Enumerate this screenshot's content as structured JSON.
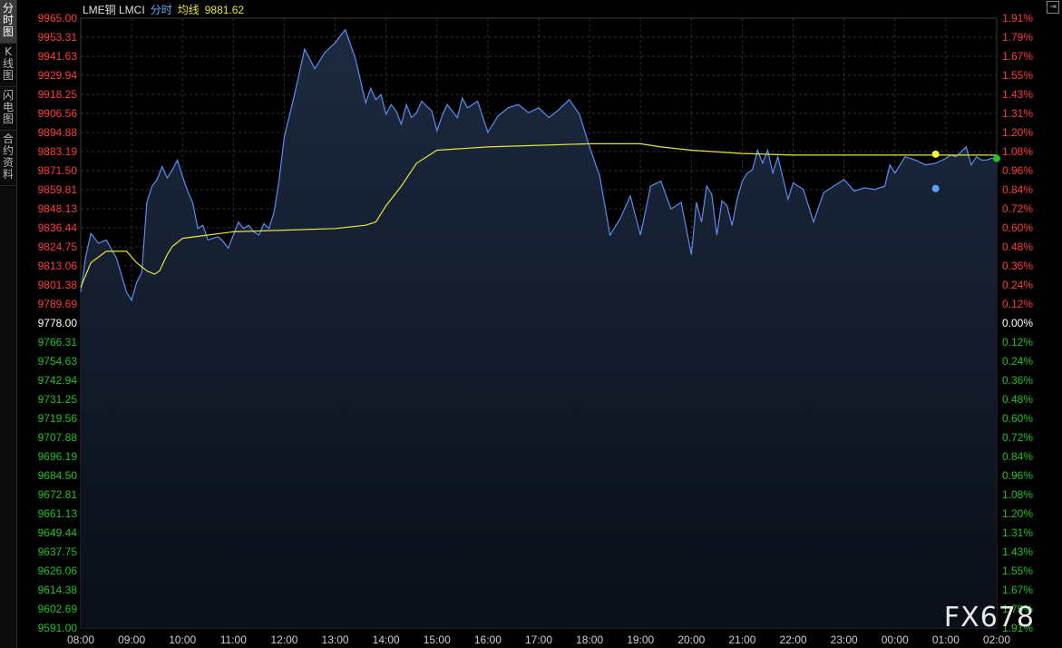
{
  "sidebar": {
    "tabs": [
      {
        "label": "分时图",
        "active": true
      },
      {
        "label": "K线图",
        "active": false
      },
      {
        "label": "闪电图",
        "active": false
      },
      {
        "label": "合约资料",
        "active": false
      }
    ]
  },
  "header": {
    "symbol": "LME铜 LMCI",
    "mode": "分时",
    "avg_label": "均线",
    "avg_value": "9881.62"
  },
  "watermark": "FX678",
  "colors": {
    "up": "#ff3b3b",
    "down": "#22c022",
    "flat": "#ffffff",
    "price_line": "#5a8ef2",
    "avg_line": "#e6e63a",
    "grid": "#2f2f2f",
    "fill_top": "#1c2a40",
    "fill_bottom": "#0a0f18"
  },
  "chart_data": {
    "type": "line",
    "title": "",
    "xlabel": "",
    "ylabel": "",
    "base_price": 9778.0,
    "ylim": [
      9591.0,
      9965.0
    ],
    "y_ticks": [
      "9965.00",
      "9953.31",
      "9941.63",
      "9929.94",
      "9918.25",
      "9906.56",
      "9894.88",
      "9883.19",
      "9871.50",
      "9859.81",
      "9848.13",
      "9836.44",
      "9824.75",
      "9813.06",
      "9801.38",
      "9789.69",
      "9778.00",
      "9766.31",
      "9754.63",
      "9742.94",
      "9731.25",
      "9719.56",
      "9707.88",
      "9696.19",
      "9684.50",
      "9672.81",
      "9661.13",
      "9649.44",
      "9637.75",
      "9626.06",
      "9614.38",
      "9602.69",
      "9591.00"
    ],
    "pct_ticks": [
      "1.91%",
      "1.79%",
      "1.67%",
      "1.55%",
      "1.43%",
      "1.31%",
      "1.20%",
      "1.08%",
      "0.96%",
      "0.84%",
      "0.72%",
      "0.60%",
      "0.48%",
      "0.36%",
      "0.24%",
      "0.12%",
      "0.00%",
      "0.12%",
      "0.24%",
      "0.36%",
      "0.48%",
      "0.60%",
      "0.72%",
      "0.84%",
      "0.96%",
      "1.08%",
      "1.20%",
      "1.31%",
      "1.43%",
      "1.55%",
      "1.67%",
      "1.79%",
      "1.91%"
    ],
    "x_ticks": [
      "08:00",
      "09:00",
      "10:00",
      "11:00",
      "12:00",
      "13:00",
      "14:00",
      "15:00",
      "16:00",
      "17:00",
      "18:00",
      "19:00",
      "20:00",
      "21:00",
      "22:00",
      "23:00",
      "00:00",
      "01:00",
      "02:00"
    ],
    "xlim_hours": [
      0,
      18
    ],
    "grid": true,
    "series": [
      {
        "name": "",
        "x": [
          0,
          0.1,
          0.2,
          0.35,
          0.5,
          0.7,
          0.9,
          1.0,
          1.1,
          1.2,
          1.3,
          1.4,
          1.5,
          1.6,
          1.7,
          1.8,
          1.9,
          2.0,
          2.1,
          2.2,
          2.3,
          2.4,
          2.5,
          2.6,
          2.7,
          2.8,
          2.9,
          3.0,
          3.1,
          3.2,
          3.3,
          3.4,
          3.5,
          3.6,
          3.7,
          3.8,
          3.9,
          4.0,
          4.2,
          4.4,
          4.6,
          4.8,
          5.0,
          5.2,
          5.4,
          5.6,
          5.7,
          5.8,
          5.9,
          6.0,
          6.1,
          6.2,
          6.3,
          6.4,
          6.5,
          6.6,
          6.7,
          6.8,
          6.9,
          7.0,
          7.1,
          7.2,
          7.3,
          7.4,
          7.5,
          7.6,
          7.8,
          8.0,
          8.2,
          8.4,
          8.6,
          8.8,
          9.0,
          9.2,
          9.4,
          9.6,
          9.8,
          10.0,
          10.2,
          10.4,
          10.6,
          10.8,
          11.0,
          11.2,
          11.4,
          11.6,
          11.8,
          12.0,
          12.1,
          12.2,
          12.3,
          12.4,
          12.5,
          12.6,
          12.7,
          12.8,
          12.9,
          13.0,
          13.1,
          13.2,
          13.3,
          13.4,
          13.5,
          13.6,
          13.7,
          13.8,
          13.9,
          14.0,
          14.2,
          14.4,
          14.6,
          14.8,
          15.0,
          15.2,
          15.4,
          15.6,
          15.8,
          15.9,
          16.0,
          16.2,
          16.4,
          16.6,
          16.8,
          17.0,
          17.1,
          17.2,
          17.3,
          17.4,
          17.5,
          17.6,
          17.7,
          17.8,
          17.9,
          18.0
        ],
        "values": [
          9797,
          9819,
          9833,
          9827,
          9829,
          9818,
          9797,
          9792,
          9803,
          9809,
          9852,
          9862,
          9866,
          9874,
          9867,
          9872,
          9878,
          9868,
          9859,
          9852,
          9836,
          9838,
          9829,
          9830,
          9831,
          9828,
          9824,
          9832,
          9840,
          9836,
          9838,
          9834,
          9832,
          9839,
          9836,
          9846,
          9866,
          9892,
          9918,
          9946,
          9934,
          9944,
          9950,
          9958,
          9940,
          9913,
          9922,
          9915,
          9918,
          9906,
          9912,
          9908,
          9900,
          9912,
          9904,
          9907,
          9914,
          9911,
          9908,
          9896,
          9905,
          9912,
          9908,
          9904,
          9916,
          9910,
          9914,
          9895,
          9905,
          9910,
          9912,
          9907,
          9910,
          9904,
          9909,
          9915,
          9906,
          9886,
          9868,
          9832,
          9842,
          9856,
          9832,
          9862,
          9865,
          9848,
          9852,
          9820,
          9852,
          9840,
          9862,
          9857,
          9832,
          9853,
          9850,
          9838,
          9854,
          9865,
          9870,
          9872,
          9884,
          9876,
          9884,
          9870,
          9880,
          9867,
          9854,
          9864,
          9860,
          9840,
          9858,
          9862,
          9866,
          9859,
          9861,
          9860,
          9862,
          9875,
          9870,
          9880,
          9878,
          9875,
          9876,
          9879,
          9881,
          9880,
          9883,
          9886,
          9875,
          9880,
          9878,
          9878,
          9879,
          9879
        ]
      },
      {
        "name": "均线",
        "x": [
          0,
          0.2,
          0.5,
          0.9,
          1.1,
          1.3,
          1.45,
          1.55,
          1.7,
          1.8,
          2.0,
          2.5,
          3.0,
          4.0,
          5.0,
          5.3,
          5.6,
          5.8,
          6.0,
          6.3,
          6.6,
          7.0,
          8.0,
          9.0,
          10.0,
          10.5,
          10.8,
          11.0,
          11.4,
          12.0,
          13.0,
          14.0,
          15.0,
          16.0,
          17.0,
          18.0
        ],
        "values": [
          9800,
          9815,
          9822,
          9822,
          9815,
          9810,
          9808,
          9810,
          9820,
          9825,
          9830,
          9832,
          9834,
          9835,
          9836,
          9837,
          9838,
          9840,
          9850,
          9862,
          9876,
          9884,
          9886,
          9887,
          9888,
          9888,
          9888,
          9888,
          9886,
          9884,
          9882,
          9881,
          9881,
          9881,
          9881,
          9881
        ]
      }
    ],
    "markers": [
      {
        "name": "avg-end-marker",
        "x": 16.8,
        "value": 9881.62,
        "color": "#f5f53a"
      },
      {
        "name": "low-marker",
        "x": 16.8,
        "value": 9860.5,
        "color": "#5aa0ff"
      },
      {
        "name": "last-price-marker",
        "x": 18.0,
        "value": 9879,
        "color": "#22c022"
      }
    ]
  }
}
